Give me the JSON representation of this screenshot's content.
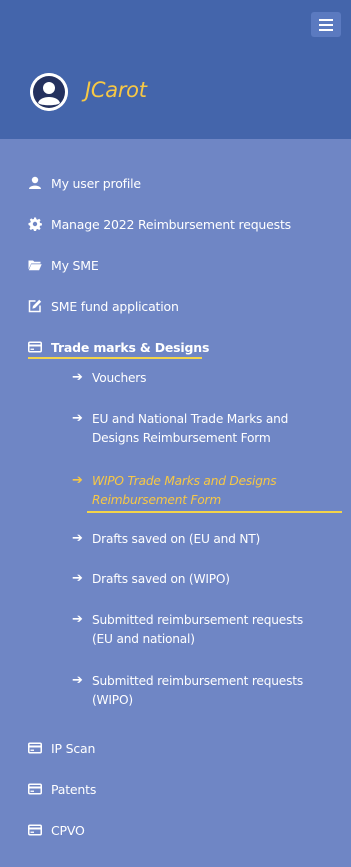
{
  "header": {
    "user_name": "JCarot"
  },
  "nav": {
    "items": [
      {
        "label": "My user profile",
        "icon": "user-icon"
      },
      {
        "label": "Manage 2022 Reimbursement requests",
        "icon": "gear-icon"
      },
      {
        "label": "My SME",
        "icon": "folder-open-icon"
      },
      {
        "label": "SME fund application",
        "icon": "edit-icon"
      },
      {
        "label": "Trade marks & Designs",
        "icon": "card-icon",
        "active": true
      },
      {
        "label": "IP Scan",
        "icon": "card-icon"
      },
      {
        "label": "Patents",
        "icon": "card-icon"
      },
      {
        "label": "CPVO",
        "icon": "card-icon"
      }
    ],
    "sub_items": [
      {
        "line1": "Vouchers",
        "line2": ""
      },
      {
        "line1": "EU and National Trade Marks and",
        "line2": "Designs Reimbursement Form"
      },
      {
        "line1": "WIPO Trade Marks and Designs",
        "line2": "Reimbursement Form",
        "current": true
      },
      {
        "line1": "Drafts saved on (EU and NT)",
        "line2": ""
      },
      {
        "line1": "Drafts saved on (WIPO)",
        "line2": ""
      },
      {
        "line1": "Submitted reimbursement requests",
        "line2": "(EU and national)"
      },
      {
        "line1": "Submitted reimbursement requests",
        "line2": "(WIPO)"
      }
    ]
  },
  "colors": {
    "header_bg": "#4465ab",
    "sidebar_bg": "#6f86c5",
    "accent": "#f7c845",
    "underline": "#f3d44a"
  }
}
